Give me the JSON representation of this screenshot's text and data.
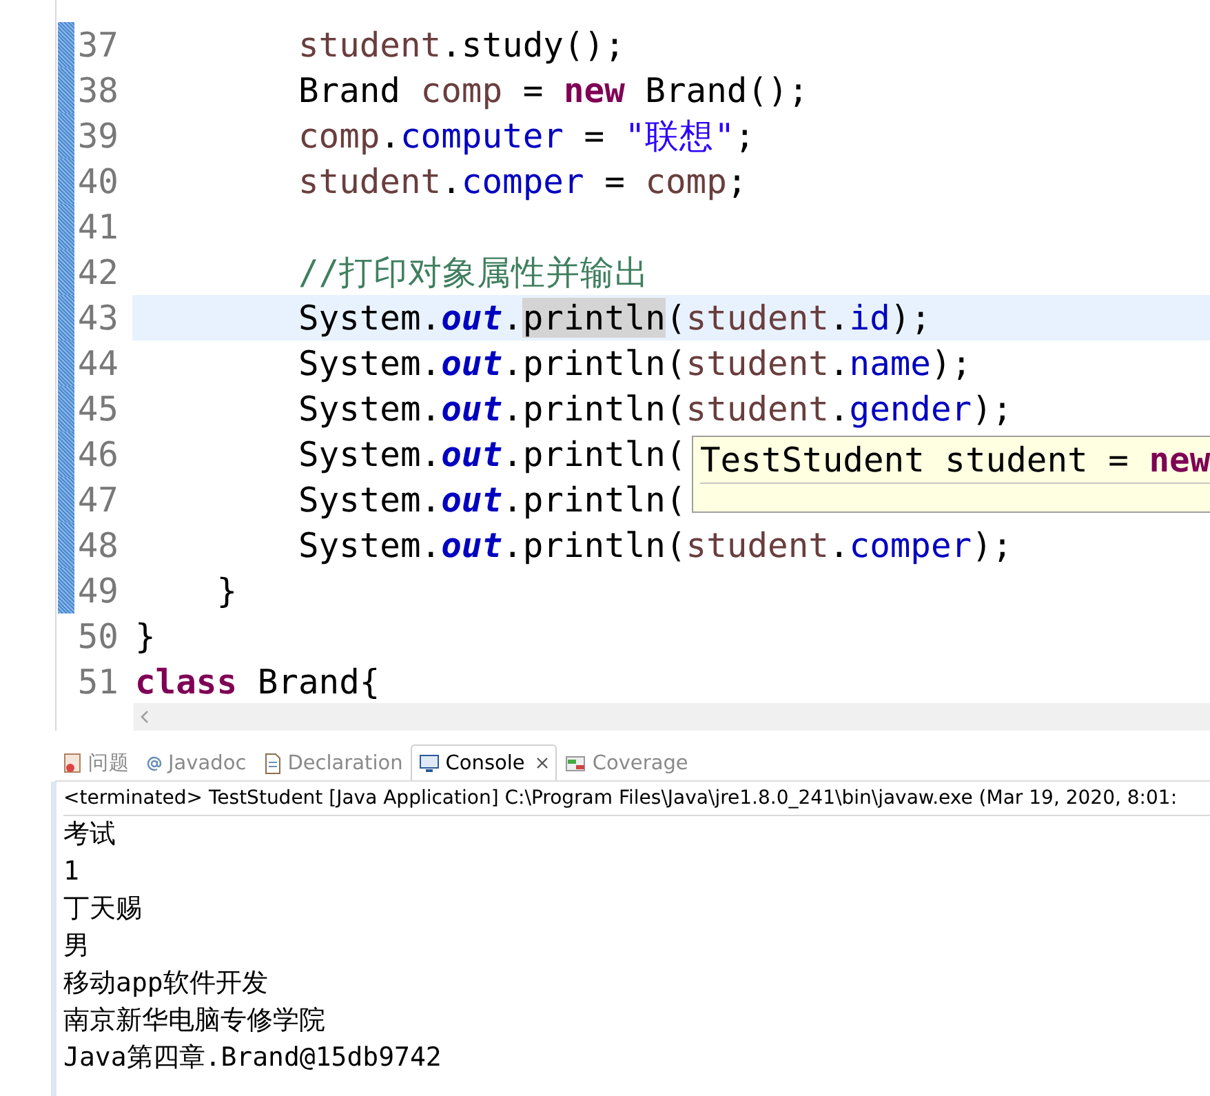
{
  "editor": {
    "lines": [
      {
        "number": "37",
        "changed": true,
        "current": false,
        "tokens": [
          {
            "text": "        student",
            "kind": "local"
          },
          {
            "text": ".study();",
            "kind": "plain"
          }
        ]
      },
      {
        "number": "38",
        "changed": true,
        "current": false,
        "tokens": [
          {
            "text": "        Brand ",
            "kind": "plain"
          },
          {
            "text": "comp",
            "kind": "local"
          },
          {
            "text": " = ",
            "kind": "plain"
          },
          {
            "text": "new",
            "kind": "keyword"
          },
          {
            "text": " Brand();",
            "kind": "plain"
          }
        ]
      },
      {
        "number": "39",
        "changed": true,
        "current": false,
        "tokens": [
          {
            "text": "        comp",
            "kind": "local"
          },
          {
            "text": ".",
            "kind": "plain"
          },
          {
            "text": "computer",
            "kind": "field"
          },
          {
            "text": " = ",
            "kind": "plain"
          },
          {
            "text": "\"联想\"",
            "kind": "string"
          },
          {
            "text": ";",
            "kind": "plain"
          }
        ]
      },
      {
        "number": "40",
        "changed": true,
        "current": false,
        "tokens": [
          {
            "text": "        student",
            "kind": "local"
          },
          {
            "text": ".",
            "kind": "plain"
          },
          {
            "text": "comper",
            "kind": "field"
          },
          {
            "text": " = ",
            "kind": "plain"
          },
          {
            "text": "comp",
            "kind": "local"
          },
          {
            "text": ";",
            "kind": "plain"
          }
        ]
      },
      {
        "number": "41",
        "changed": true,
        "current": false
      },
      {
        "number": "42",
        "changed": true,
        "current": false,
        "tokens": [
          {
            "text": "        //打印对象属性并输出",
            "kind": "comment"
          }
        ]
      },
      {
        "number": "43",
        "changed": true,
        "current": true,
        "tokens": [
          {
            "text": "        System.",
            "kind": "plain"
          },
          {
            "text": "out",
            "kind": "static"
          },
          {
            "text": ".",
            "kind": "plain"
          },
          {
            "text": "println",
            "kind": "plain",
            "highlighted": true
          },
          {
            "text": "(",
            "kind": "plain"
          },
          {
            "text": "student",
            "kind": "local"
          },
          {
            "text": ".",
            "kind": "plain"
          },
          {
            "text": "id",
            "kind": "field"
          },
          {
            "text": ");",
            "kind": "plain"
          }
        ]
      },
      {
        "number": "44",
        "changed": true,
        "current": false,
        "tokens": [
          {
            "text": "        System.",
            "kind": "plain"
          },
          {
            "text": "out",
            "kind": "static"
          },
          {
            "text": ".println(",
            "kind": "plain"
          },
          {
            "text": "student",
            "kind": "local"
          },
          {
            "text": ".",
            "kind": "plain"
          },
          {
            "text": "name",
            "kind": "field"
          },
          {
            "text": ");",
            "kind": "plain"
          }
        ]
      },
      {
        "number": "45",
        "changed": true,
        "current": false,
        "tokens": [
          {
            "text": "        System.",
            "kind": "plain"
          },
          {
            "text": "out",
            "kind": "static"
          },
          {
            "text": ".println(",
            "kind": "plain"
          },
          {
            "text": "student",
            "kind": "local"
          },
          {
            "text": ".",
            "kind": "plain"
          },
          {
            "text": "gender",
            "kind": "field"
          },
          {
            "text": ");",
            "kind": "plain"
          }
        ]
      },
      {
        "number": "46",
        "changed": true,
        "current": false,
        "tokens": [
          {
            "text": "        System.",
            "kind": "plain"
          },
          {
            "text": "out",
            "kind": "static"
          },
          {
            "text": ".println(",
            "kind": "plain"
          }
        ]
      },
      {
        "number": "47",
        "changed": true,
        "current": false,
        "tokens": [
          {
            "text": "        System.",
            "kind": "plain"
          },
          {
            "text": "out",
            "kind": "static"
          },
          {
            "text": ".println(",
            "kind": "plain"
          }
        ]
      },
      {
        "number": "48",
        "changed": true,
        "current": false,
        "tokens": [
          {
            "text": "        System.",
            "kind": "plain"
          },
          {
            "text": "out",
            "kind": "static"
          },
          {
            "text": ".println(",
            "kind": "plain"
          },
          {
            "text": "student",
            "kind": "local"
          },
          {
            "text": ".",
            "kind": "plain"
          },
          {
            "text": "comper",
            "kind": "field"
          },
          {
            "text": ");",
            "kind": "plain"
          }
        ]
      },
      {
        "number": "49",
        "changed": true,
        "current": false,
        "tokens": [
          {
            "text": "    }",
            "kind": "plain"
          }
        ]
      },
      {
        "number": "50",
        "changed": false,
        "current": false,
        "tokens": [
          {
            "text": "}",
            "kind": "plain"
          }
        ]
      },
      {
        "number": "51",
        "changed": false,
        "current": false,
        "tokens": [
          {
            "text": "class",
            "kind": "keyword"
          },
          {
            "text": " Brand{",
            "kind": "plain"
          }
        ]
      }
    ],
    "hover": {
      "tokens": [
        {
          "text": "TestStudent student = ",
          "kind": "plain"
        },
        {
          "text": "new",
          "kind": "keyword"
        }
      ]
    }
  },
  "tabs": [
    {
      "label": "问题",
      "kind": "problems",
      "selected": false,
      "closable": false
    },
    {
      "label": "Javadoc",
      "kind": "javadoc",
      "selected": false,
      "closable": false
    },
    {
      "label": "Declaration",
      "kind": "declaration",
      "selected": false,
      "closable": false
    },
    {
      "label": "Console",
      "kind": "console",
      "selected": true,
      "closable": true
    },
    {
      "label": "Coverage",
      "kind": "coverage",
      "selected": false,
      "closable": false
    }
  ],
  "console": {
    "status": "<terminated> TestStudent [Java Application] C:\\Program Files\\Java\\jre1.8.0_241\\bin\\javaw.exe (Mar 19, 2020, 8:01:",
    "output": [
      "考试",
      "1",
      "丁天赐",
      "男",
      "移动app软件开发",
      "南京新华电脑专修学院",
      "Java第四章.Brand@15db9742"
    ]
  }
}
